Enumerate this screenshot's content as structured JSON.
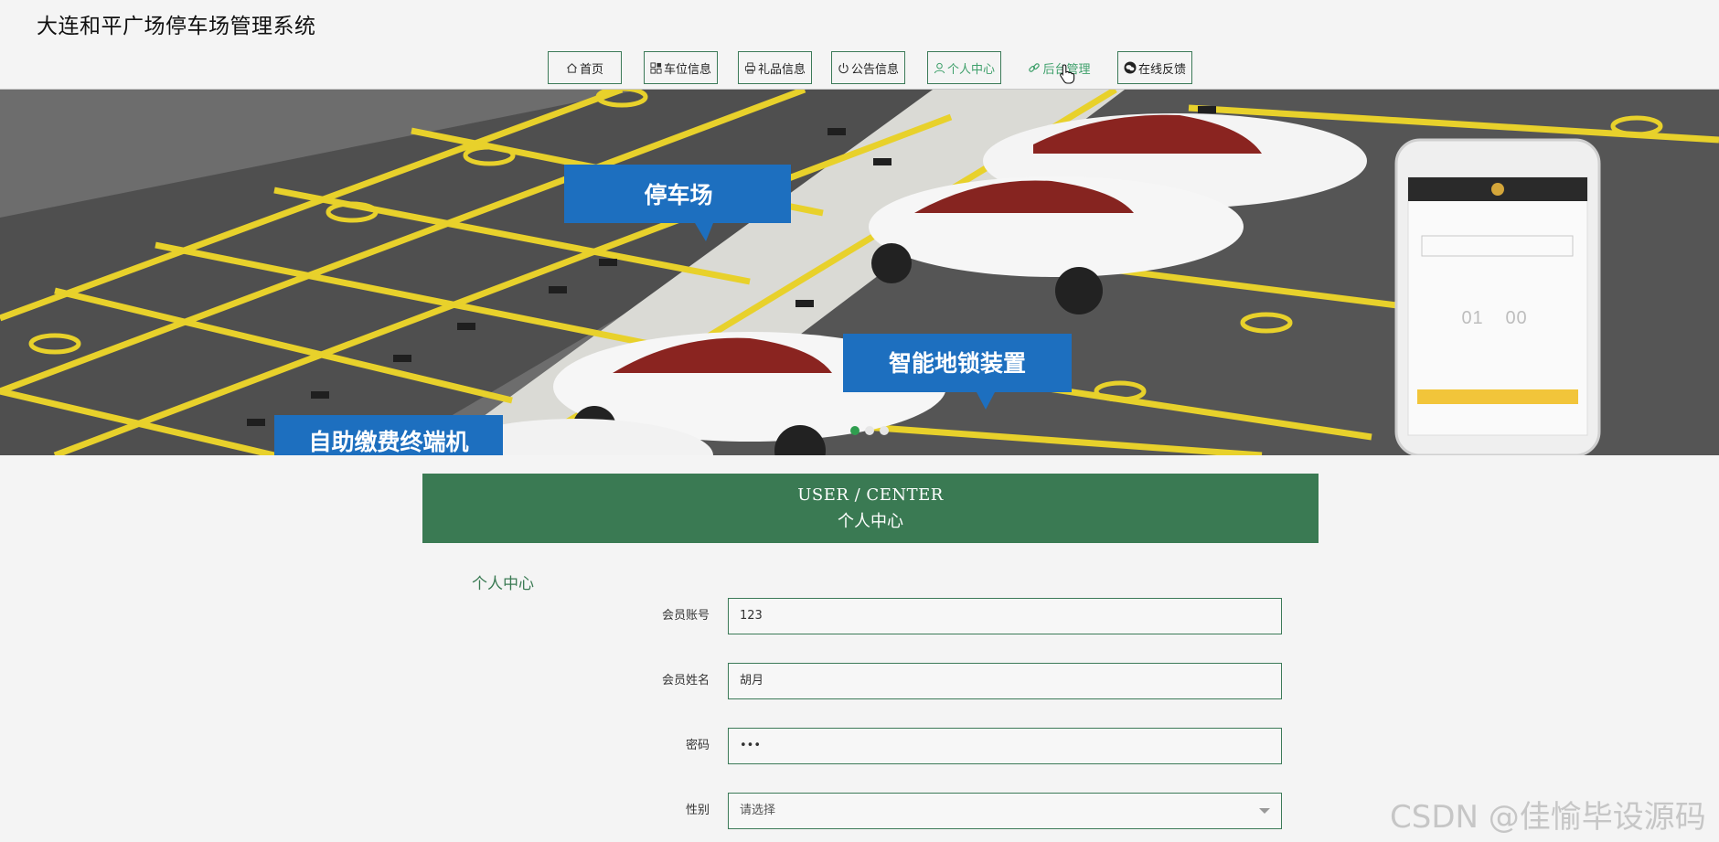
{
  "header": {
    "site_title": "大连和平广场停车场管理系统",
    "nav": [
      {
        "label": "首页",
        "icon": "home-icon"
      },
      {
        "label": "车位信息",
        "icon": "grid-icon"
      },
      {
        "label": "礼品信息",
        "icon": "printer-icon"
      },
      {
        "label": "公告信息",
        "icon": "power-icon"
      },
      {
        "label": "个人中心",
        "icon": "user-icon"
      },
      {
        "label": "后台管理",
        "icon": "link-icon"
      },
      {
        "label": "在线反馈",
        "icon": "wechat-icon"
      }
    ],
    "active_nav_color": "#3fa06b"
  },
  "banner": {
    "callout_1": "停车场",
    "callout_2": "智能地锁装置",
    "callout_3": "自助缴费终端机",
    "phone_numbers": [
      "0",
      "1",
      "0",
      "0"
    ],
    "slide_count": 3,
    "active_slide": 1
  },
  "section": {
    "title_en": "USER / CENTER",
    "title_cn": "个人中心",
    "accent_color": "#3a7a53"
  },
  "form": {
    "title": "个人中心",
    "fields": [
      {
        "label": "会员账号",
        "value": "123"
      },
      {
        "label": "会员姓名",
        "value": "胡月"
      },
      {
        "label": "密码",
        "value": "•••"
      },
      {
        "label": "性别",
        "value": "请选择"
      }
    ]
  },
  "watermark": "CSDN @佳愉毕设源码"
}
